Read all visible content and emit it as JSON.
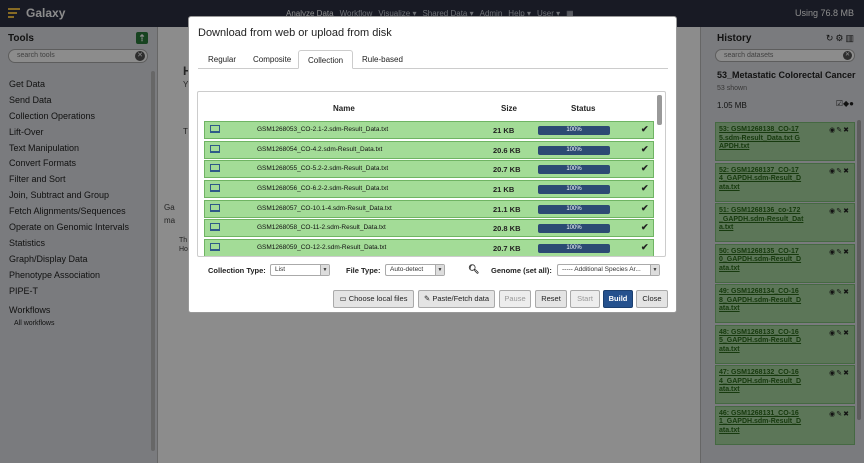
{
  "topbar": {
    "brand": "Galaxy",
    "nav": [
      "Analyze Data",
      "Workflow",
      "Visualize ▾",
      "Shared Data ▾",
      "Admin",
      "Help ▾",
      "User ▾",
      "▦"
    ],
    "usage": "Using 76.8 MB"
  },
  "tools": {
    "header": "Tools",
    "search_placeholder": "search tools",
    "items": [
      "Get Data",
      "Send Data",
      "Collection Operations",
      "Lift-Over",
      "Text Manipulation",
      "Convert Formats",
      "Filter and Sort",
      "Join, Subtract and Group",
      "Fetch Alignments/Sequences",
      "Operate on Genomic Intervals",
      "Statistics",
      "Graph/Display Data",
      "Phenotype Association",
      "PIPE-T"
    ],
    "workflows": "Workflows",
    "all_workflows": "All workflows"
  },
  "center": {
    "frag1": "H",
    "frag2": "Y",
    "frag3": "T",
    "frag4": "Ga",
    "frag5": "ma",
    "frag6": "Th",
    "frag7": "Ho"
  },
  "history": {
    "header": "History",
    "search_placeholder": "search datasets",
    "name": "53_Metastatic Colorectal Cancer",
    "shown": "53 shown",
    "size": "1.05 MB",
    "datasets": [
      "53: GSM1268138_CO-17 5.sdm-Result_Data.txt G APDH.txt",
      "52: GSM1268137_CO-17 4_GAPDH.sdm-Result_D ata.txt",
      "51: GSM1268136_co-172 _GAPDH.sdm-Result_Dat a.txt",
      "50: GSM1268135_CO-17 0_GAPDH.sdm-Result_D ata.txt",
      "49: GSM1268134_CO-16 8_GAPDH.sdm-Result_D ata.txt",
      "48: GSM1268133_CO-16 5_GAPDH.sdm-Result_D ata.txt",
      "47: GSM1268132_CO-16 4_GAPDH.sdm-Result_D ata.txt",
      "46: GSM1268131_CO-16 1_GAPDH.sdm-Result_D ata.txt"
    ]
  },
  "modal": {
    "title": "Download from web or upload from disk",
    "tabs": [
      "Regular",
      "Composite",
      "Collection",
      "Rule-based"
    ],
    "columns": {
      "name": "Name",
      "size": "Size",
      "status": "Status"
    },
    "files": [
      {
        "name": "GSM1268053_CO-2.1-2.sdm-Result_Data.txt",
        "size": "21 KB",
        "progress": "100%"
      },
      {
        "name": "GSM1268054_CO-4.2.sdm-Result_Data.txt",
        "size": "20.6 KB",
        "progress": "100%"
      },
      {
        "name": "GSM1268055_CO-5.2-2.sdm-Result_Data.txt",
        "size": "20.7 KB",
        "progress": "100%"
      },
      {
        "name": "GSM1268056_CO-6.2-2.sdm-Result_Data.txt",
        "size": "21 KB",
        "progress": "100%"
      },
      {
        "name": "GSM1268057_CO-10.1-4.sdm-Result_Data.txt",
        "size": "21.1 KB",
        "progress": "100%"
      },
      {
        "name": "GSM1268058_CO-11-2.sdm-Result_Data.txt",
        "size": "20.8 KB",
        "progress": "100%"
      },
      {
        "name": "GSM1268059_CO-12-2.sdm-Result_Data.txt",
        "size": "20.7 KB",
        "progress": "100%"
      }
    ],
    "collection_type_label": "Collection Type:",
    "collection_type_value": "List",
    "file_type_label": "File Type:",
    "file_type_value": "Auto-detect",
    "genome_label": "Genome (set all):",
    "genome_value": "----- Additional Species Ar...",
    "buttons": {
      "choose": "Choose local files",
      "paste": "Paste/Fetch data",
      "pause": "Pause",
      "reset": "Reset",
      "start": "Start",
      "build": "Build",
      "close": "Close"
    }
  }
}
